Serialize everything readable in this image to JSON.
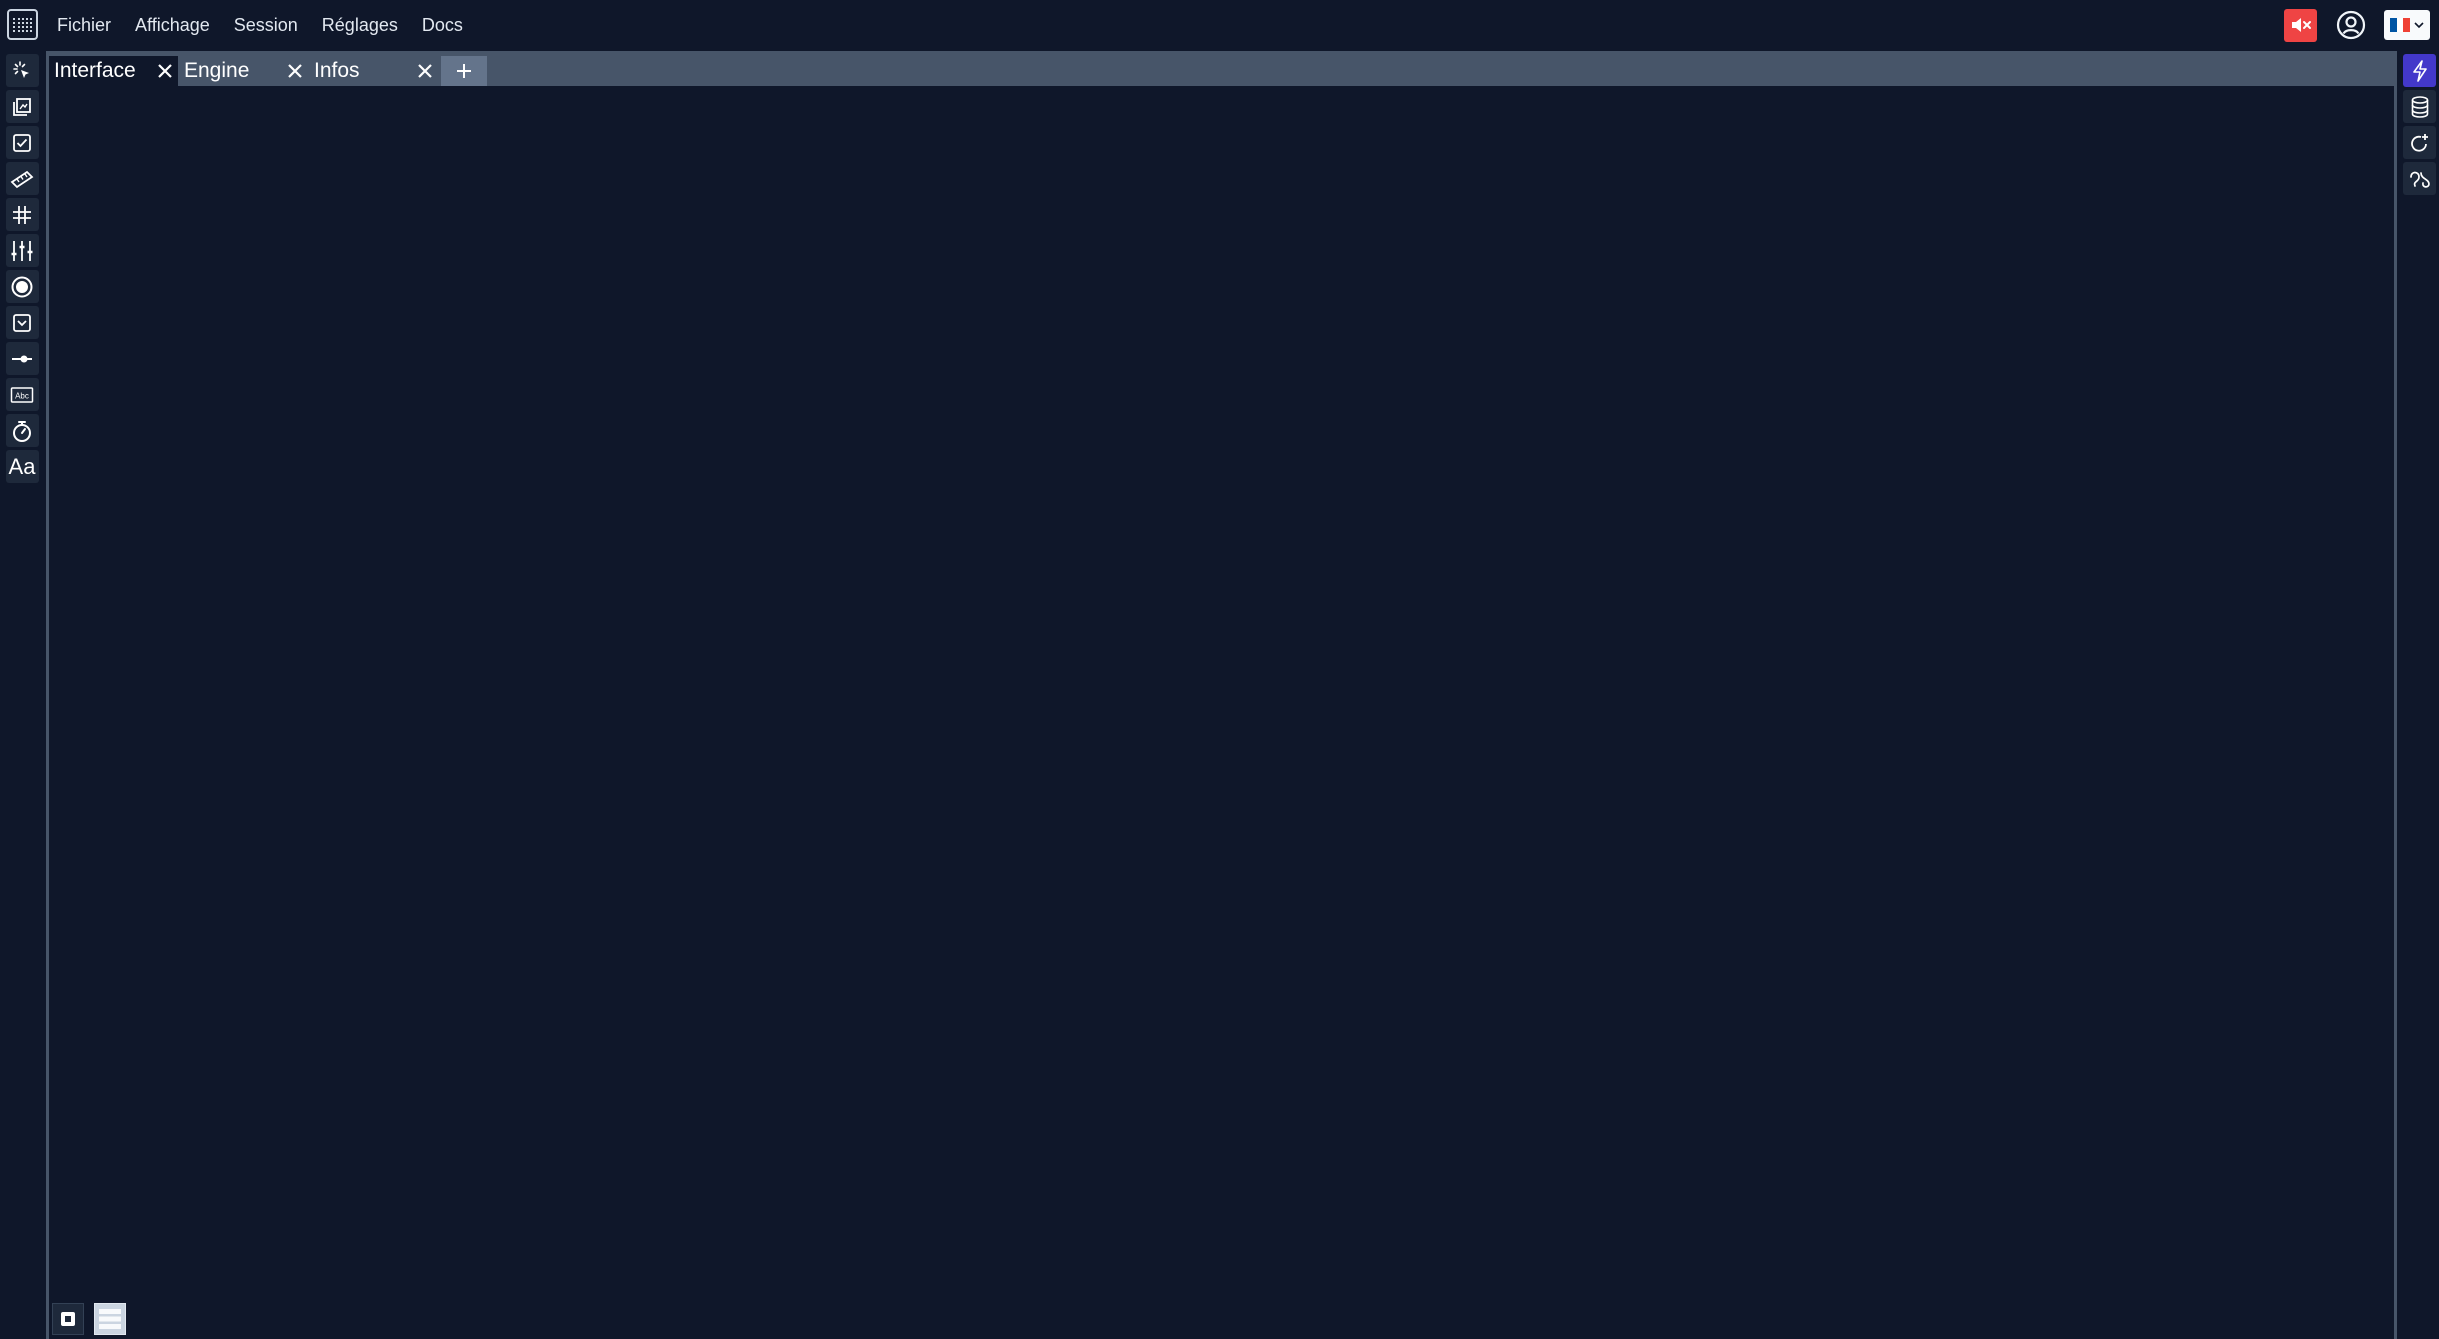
{
  "menu": {
    "items": [
      "Fichier",
      "Affichage",
      "Session",
      "Réglages",
      "Docs"
    ]
  },
  "header": {
    "logo_icon": "app-logo-icon",
    "mute_icon": "volume-mute-icon",
    "user_icon": "user-circle-icon",
    "language_flag": "flag-fr-icon",
    "colors": {
      "mute_bg": "#ef4444",
      "flag_blue": "#0055a4",
      "flag_white": "#ffffff",
      "flag_red": "#ef4135"
    }
  },
  "left_toolbar": {
    "tools": [
      {
        "icon": "cursor-click-icon"
      },
      {
        "icon": "copy-stack-icon"
      },
      {
        "icon": "checkbox-icon"
      },
      {
        "icon": "ruler-icon"
      },
      {
        "icon": "grid-hash-icon"
      },
      {
        "icon": "sliders-icon"
      },
      {
        "icon": "radio-button-icon"
      },
      {
        "icon": "dropdown-icon"
      },
      {
        "icon": "slider-handle-icon"
      },
      {
        "icon": "text-field-icon",
        "text": "Abc"
      },
      {
        "icon": "stopwatch-icon"
      },
      {
        "icon": "font-icon",
        "text": "Aa"
      }
    ]
  },
  "right_toolbar": {
    "tools": [
      {
        "icon": "lightning-icon",
        "active": true
      },
      {
        "icon": "database-icon"
      },
      {
        "icon": "refresh-plus-icon"
      },
      {
        "icon": "scripts-icon"
      }
    ],
    "accent": "#4338ca"
  },
  "tabs": [
    {
      "label": "Interface",
      "active": true
    },
    {
      "label": "Engine",
      "active": false
    },
    {
      "label": "Infos",
      "active": false
    }
  ],
  "bottom_controls": [
    {
      "icon": "screen-capture-icon"
    },
    {
      "icon": "list-rows-icon"
    }
  ]
}
